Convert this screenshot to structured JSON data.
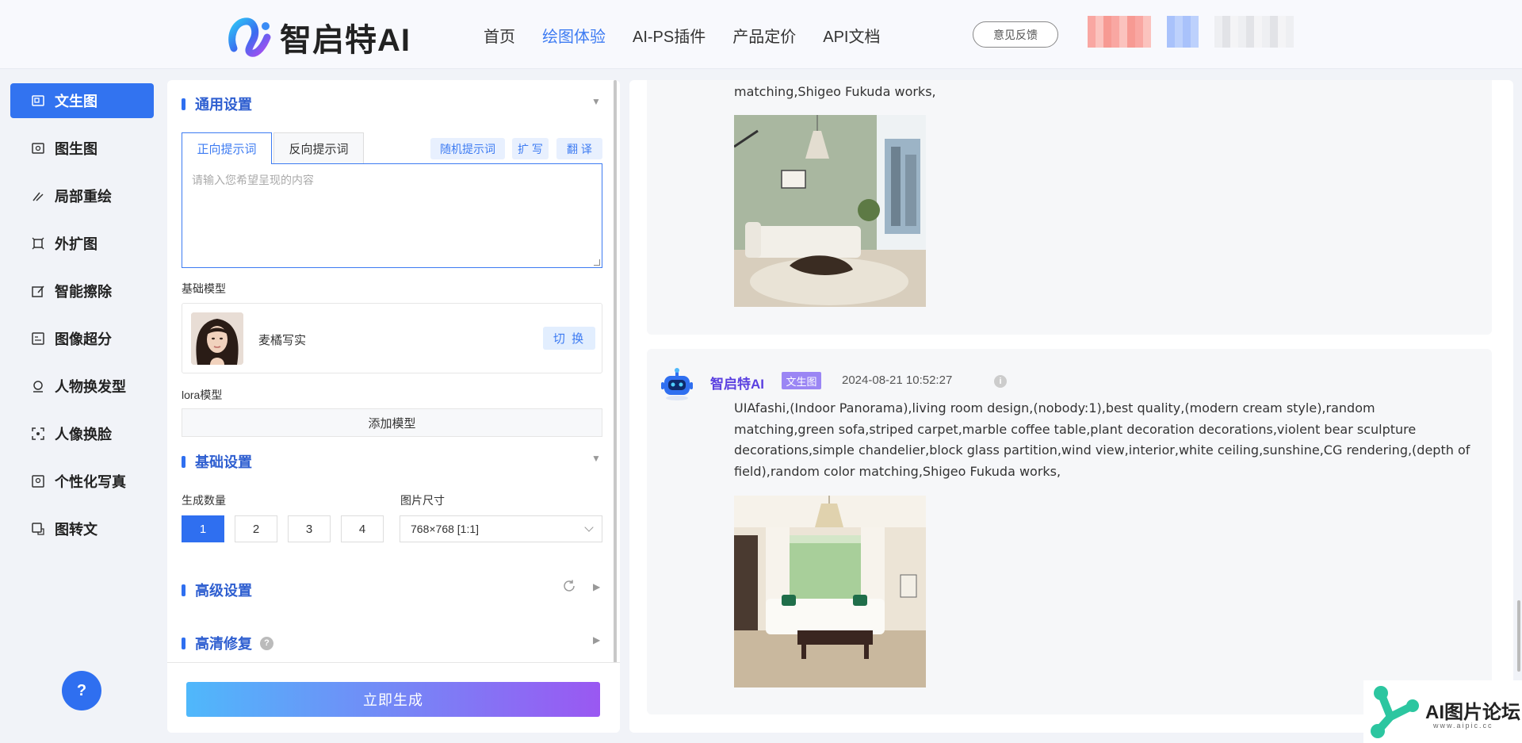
{
  "header": {
    "logo_text": "智启特AI",
    "nav": [
      "首页",
      "绘图体验",
      "AI-PS插件",
      "产品定价",
      "API文档"
    ],
    "active_nav": 1,
    "feedback_label": "意见反馈"
  },
  "sidebar": {
    "items": [
      {
        "label": "文生图",
        "icon": "text-image-icon"
      },
      {
        "label": "图生图",
        "icon": "image-image-icon"
      },
      {
        "label": "局部重绘",
        "icon": "brush-icon"
      },
      {
        "label": "外扩图",
        "icon": "expand-icon"
      },
      {
        "label": "智能擦除",
        "icon": "eraser-icon"
      },
      {
        "label": "图像超分",
        "icon": "upscale-icon"
      },
      {
        "label": "人物换发型",
        "icon": "hair-icon"
      },
      {
        "label": "人像换脸",
        "icon": "face-swap-icon"
      },
      {
        "label": "个性化写真",
        "icon": "portrait-icon"
      },
      {
        "label": "图转文",
        "icon": "image-text-icon"
      }
    ],
    "active": 0,
    "help_label": "?"
  },
  "settings": {
    "general_title": "通用设置",
    "tab_positive": "正向提示词",
    "tab_negative": "反向提示词",
    "random_prompt": "随机提示词",
    "expand_label": "扩 写",
    "translate_label": "翻 译",
    "prompt_placeholder": "请输入您希望呈现的内容",
    "base_model_label": "基础模型",
    "model_name": "麦橘写实",
    "switch_label": "切 换",
    "lora_label": "lora模型",
    "add_model_label": "添加模型",
    "basic_title": "基础设置",
    "count_label": "生成数量",
    "count_options": [
      "1",
      "2",
      "3",
      "4"
    ],
    "count_selected": 0,
    "size_label": "图片尺寸",
    "size_value": "768×768 [1:1]",
    "advanced_title": "高级设置",
    "hires_title": "高清修复",
    "hires_help": "?",
    "generate_label": "立即生成"
  },
  "results": {
    "card1_text_tail": "matching,Shigeo Fukuda works,",
    "card2": {
      "bot_name": "智启特AI",
      "tag": "文生图",
      "time": "2024-08-21 10:52:27",
      "info": "i",
      "prompt": "UIAfashi,(Indoor Panorama),living room design,(nobody:1),best quality,(modern cream style),random matching,green sofa,striped carpet,marble coffee table,plant decoration decorations,violent bear sculpture decorations,simple chandelier,block glass partition,wind view,interior,white ceiling,sunshine,CG rendering,(depth of field),random color matching,Shigeo Fukuda works,"
    }
  },
  "watermark": {
    "text": "AI图片论坛",
    "sub": "www.aipic.cc"
  },
  "colors": {
    "primary": "#2f6ff0",
    "nav_active": "#3d7bf2",
    "bot_name": "#5a3fe0",
    "tag_bg": "#9b86f4"
  }
}
